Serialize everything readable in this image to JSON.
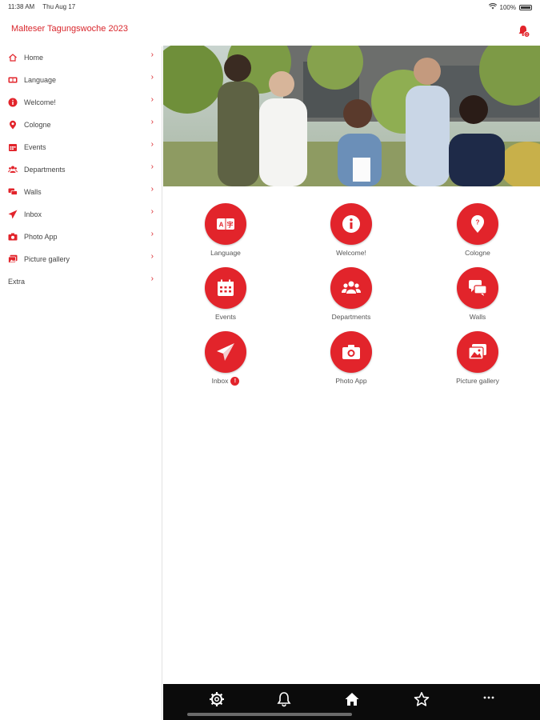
{
  "status_bar": {
    "time": "11:38 AM",
    "date": "Thu Aug 17",
    "battery": "100%"
  },
  "header": {
    "app_title": "Malteser Tagungswoche 2023"
  },
  "sidebar": {
    "items": [
      {
        "label": "Home",
        "icon": "home-icon"
      },
      {
        "label": "Language",
        "icon": "language-icon"
      },
      {
        "label": "Welcome!",
        "icon": "info-icon"
      },
      {
        "label": "Cologne",
        "icon": "location-pin-icon"
      },
      {
        "label": "Events",
        "icon": "calendar-icon"
      },
      {
        "label": "Departments",
        "icon": "users-icon"
      },
      {
        "label": "Walls",
        "icon": "chat-icon"
      },
      {
        "label": "Inbox",
        "icon": "paper-plane-icon"
      },
      {
        "label": "Photo App",
        "icon": "camera-icon"
      },
      {
        "label": "Picture gallery",
        "icon": "gallery-icon"
      },
      {
        "label": "Extra",
        "icon": ""
      }
    ]
  },
  "tiles": [
    {
      "label": "Language",
      "icon": "language-icon"
    },
    {
      "label": "Welcome!",
      "icon": "info-icon"
    },
    {
      "label": "Cologne",
      "icon": "location-pin-icon"
    },
    {
      "label": "Events",
      "icon": "calendar-icon"
    },
    {
      "label": "Departments",
      "icon": "users-icon"
    },
    {
      "label": "Walls",
      "icon": "chat-icon"
    },
    {
      "label": "Inbox",
      "icon": "paper-plane-icon",
      "badge": "!"
    },
    {
      "label": "Photo App",
      "icon": "camera-icon"
    },
    {
      "label": "Picture gallery",
      "icon": "gallery-icon"
    }
  ],
  "tab_bar": {
    "tabs": [
      "settings-icon",
      "bell-icon",
      "home-icon",
      "star-icon",
      "more-icon"
    ]
  },
  "colors": {
    "accent": "#e2242b",
    "tab_bar": "#0b0b0b"
  }
}
